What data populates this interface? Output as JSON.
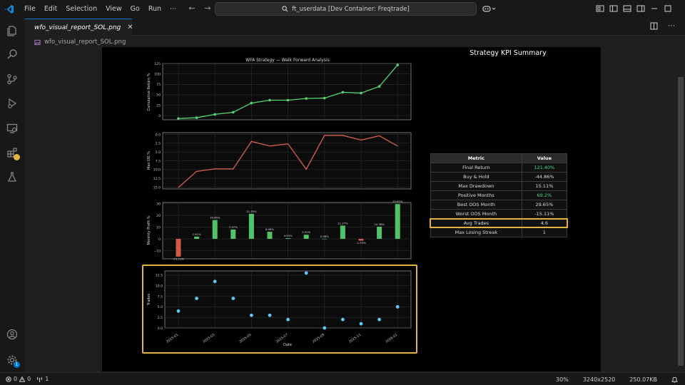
{
  "window": {
    "menu": [
      "File",
      "Edit",
      "Selection",
      "View",
      "Go",
      "Run",
      "⋯"
    ],
    "command_center": "ft_userdata [Dev Container: Freqtrade]"
  },
  "tab": {
    "label": "wfo_visual_report_SOL.png"
  },
  "breadcrumb": "wfo_visual_report_SOL.png",
  "report": {
    "cum_title": "WFA Strategy — Walk Forward Analysis",
    "cum_ylabel": "Cumulative Return %",
    "dd_ylabel": "Max DD %",
    "monthly_ylabel": "Monthly Profit %",
    "trades_ylabel": "Trades",
    "trades_xlabel": "Date",
    "kpi_title": "Strategy KPI Summary"
  },
  "chart_data": [
    {
      "type": "line",
      "title": "WFA Strategy — Walk Forward Analysis",
      "ylabel": "Cumulative Return %",
      "ylim": [
        -10,
        125
      ],
      "yticks": [
        "125",
        "100",
        "75",
        "50",
        "25",
        "0"
      ],
      "values": [
        -7,
        -5,
        3,
        8,
        30,
        37,
        37,
        41,
        42,
        56,
        54,
        70,
        121.4
      ],
      "color": "#52d66f",
      "grid": true
    },
    {
      "type": "line",
      "ylabel": "Max DD %",
      "ylim": [
        -0.5,
        15.5
      ],
      "inverted": true,
      "yticks": [
        "0.0",
        "2.5",
        "5.0",
        "7.5",
        "10.0",
        "12.5",
        "15.0"
      ],
      "values": [
        15.1,
        10.5,
        9.8,
        9.8,
        2.0,
        3.3,
        2.7,
        9.9,
        0.3,
        0.3,
        1.6,
        0.4,
        3.3
      ],
      "color": "#d9614f",
      "grid": true
    },
    {
      "type": "bar",
      "ylabel": "Monthly Profit %",
      "ylim": [
        -17,
        31
      ],
      "yticks": [
        "30",
        "20",
        "10",
        "0",
        "−10"
      ],
      "values": [
        -15.11,
        1.91,
        16.06,
        7.97,
        21.35,
        6.06,
        0.55,
        3.52,
        0.08,
        11.27,
        -1.55,
        10.38,
        29.65
      ],
      "data_labels": [
        "-15.11%",
        "1.91%",
        "16.06%",
        "7.97%",
        "21.35%",
        "6.06%",
        "0.55%",
        "3.52%",
        "0.08%",
        "11.27%",
        "-1.55%",
        "10.38%",
        "29.65%"
      ],
      "positive_color": "#4fc26a",
      "negative_color": "#cf5a4c",
      "grid": true
    },
    {
      "type": "scatter",
      "xlabel": "Date",
      "ylabel": "Trades",
      "ylim": [
        0,
        13.5
      ],
      "yticks": [
        "12.5",
        "10.0",
        "7.5",
        "5.0",
        "2.5",
        "0.0"
      ],
      "x_ticklabels": [
        "2025-01",
        "2025-03",
        "2025-05",
        "2025-07",
        "2025-09",
        "2025-11",
        "2026-01"
      ],
      "values": [
        4,
        7,
        11,
        7,
        3,
        3,
        2,
        13,
        0,
        2,
        1,
        2,
        5
      ],
      "color": "#5fc8f5",
      "grid": true
    }
  ],
  "kpi": {
    "headers": [
      "Metric",
      "Value"
    ],
    "rows": [
      {
        "metric": "Final Return",
        "value": "121.40%",
        "color": "#3ddc84"
      },
      {
        "metric": "Buy & Hold",
        "value": "-44.86%"
      },
      {
        "metric": "Max Drawdown",
        "value": "15.11%"
      },
      {
        "metric": "Positive Months",
        "value": "69.2%",
        "color": "#3ddc84"
      },
      {
        "metric": "Best OOS Month",
        "value": "29.65%"
      },
      {
        "metric": "Worst OOS Month",
        "value": "-15.11%"
      },
      {
        "metric": "Avg Trades",
        "value": "4.6"
      },
      {
        "metric": "Max Losing Streak",
        "value": "1"
      }
    ]
  },
  "statusbar": {
    "errors": "0",
    "warnings": "0",
    "ports": "1",
    "zoom": "30%",
    "dimensions": "3240x2520",
    "filesize": "250.07KB"
  },
  "badges": {
    "accounts": "1"
  },
  "colors": {
    "accent": "#0078d4",
    "highlight": "#e3b341"
  }
}
